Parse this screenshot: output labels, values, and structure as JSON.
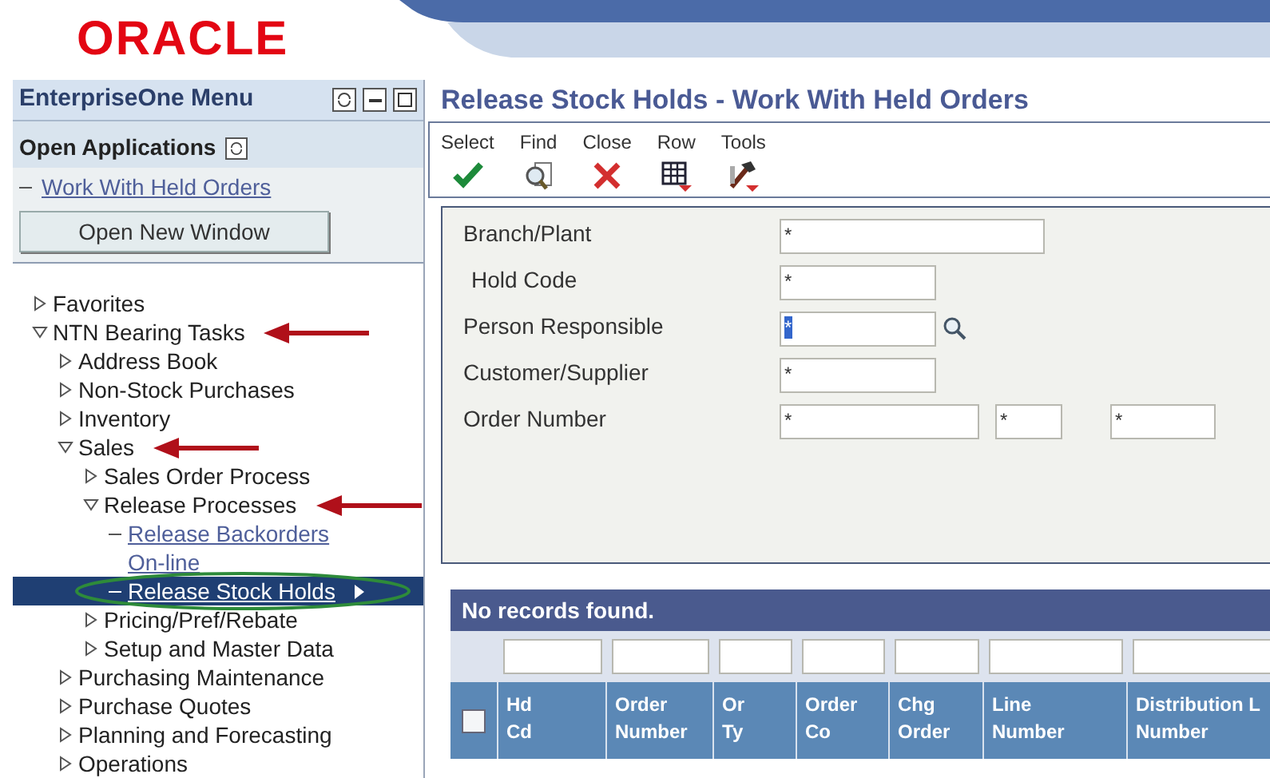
{
  "logo": "ORACLE",
  "menu": {
    "title": "EnterpriseOne Menu",
    "open_applications": {
      "title": "Open Applications",
      "items": [
        {
          "label": "Work With Held Orders"
        }
      ],
      "button": "Open New Window"
    },
    "tree": [
      {
        "label": "Favorites",
        "kind": "folder",
        "expanded": false,
        "selected": false
      },
      {
        "label": "NTN Bearing Tasks",
        "kind": "folder",
        "expanded": true,
        "selected": false,
        "arrow": true,
        "children": [
          {
            "label": "Address Book",
            "kind": "folder",
            "expanded": false,
            "selected": false
          },
          {
            "label": "Non-Stock Purchases",
            "kind": "folder",
            "expanded": false,
            "selected": false
          },
          {
            "label": "Inventory",
            "kind": "folder",
            "expanded": false,
            "selected": false
          },
          {
            "label": "Sales",
            "kind": "folder",
            "expanded": true,
            "selected": false,
            "arrow": true,
            "children": [
              {
                "label": "Sales Order Process",
                "kind": "folder",
                "expanded": false,
                "selected": false
              },
              {
                "label": "Release Processes",
                "kind": "folder",
                "expanded": true,
                "selected": false,
                "arrow": true,
                "children": [
                  {
                    "label": "Release Backorders On-line",
                    "kind": "link",
                    "selected": false
                  },
                  {
                    "label": "Release Stock Holds",
                    "kind": "link",
                    "selected": true,
                    "circled": true
                  }
                ]
              },
              {
                "label": "Pricing/Pref/Rebate",
                "kind": "folder",
                "expanded": false,
                "selected": false
              },
              {
                "label": "Setup and Master Data",
                "kind": "folder",
                "expanded": false,
                "selected": false
              }
            ]
          },
          {
            "label": "Purchasing Maintenance",
            "kind": "folder",
            "expanded": false,
            "selected": false
          },
          {
            "label": "Purchase Quotes",
            "kind": "folder",
            "expanded": false,
            "selected": false
          },
          {
            "label": "Planning and Forecasting",
            "kind": "folder",
            "expanded": false,
            "selected": false
          },
          {
            "label": "Operations",
            "kind": "folder",
            "expanded": false,
            "selected": false
          }
        ]
      }
    ]
  },
  "form": {
    "title": "Release Stock Holds - Work With Held Orders",
    "toolbar": [
      {
        "label": "Select",
        "kind": "select"
      },
      {
        "label": "Find",
        "kind": "find"
      },
      {
        "label": "Close",
        "kind": "close"
      },
      {
        "label": "Row",
        "kind": "row"
      },
      {
        "label": "Tools",
        "kind": "tools"
      }
    ],
    "fields": [
      {
        "label": "Branch/Plant",
        "inputs": [
          {
            "value": "*",
            "selected": false
          }
        ]
      },
      {
        "label": "Hold Code",
        "inputs": [
          {
            "value": "*",
            "selected": false
          }
        ]
      },
      {
        "label": "Person Responsible",
        "lookup": true,
        "inputs": [
          {
            "value": "*",
            "selected": true
          }
        ]
      },
      {
        "label": "Customer/Supplier",
        "inputs": [
          {
            "value": "*",
            "selected": false
          }
        ]
      },
      {
        "label": "Order Number",
        "inputs": [
          {
            "value": "*",
            "selected": false
          },
          {
            "value": "*",
            "selected": false
          },
          {
            "value": "*",
            "selected": false
          }
        ]
      }
    ]
  },
  "grid": {
    "message": "No records found.",
    "select_all": {
      "checked": false
    },
    "columns": [
      {
        "lines": [
          "Hd",
          "Cd"
        ]
      },
      {
        "lines": [
          "Order",
          "Number"
        ]
      },
      {
        "lines": [
          "Or",
          "Ty"
        ]
      },
      {
        "lines": [
          "Order",
          "Co"
        ]
      },
      {
        "lines": [
          "Chg",
          "Order"
        ]
      },
      {
        "lines": [
          "Line",
          "Number"
        ]
      },
      {
        "lines": [
          "Distribution L",
          "Number"
        ]
      }
    ]
  }
}
